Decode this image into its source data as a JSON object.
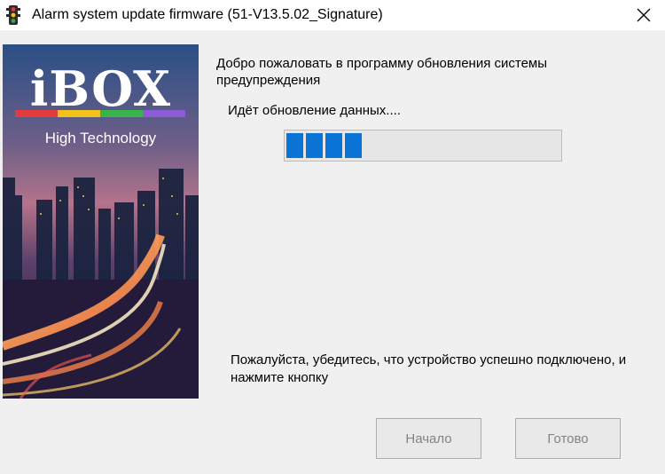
{
  "window": {
    "title": "Alarm system update firmware (51-V13.5.02_Signature)",
    "icon": "traffic-light-icon",
    "close_icon": "close-icon"
  },
  "banner": {
    "logo_text": "iBOX",
    "tagline": "High Technology",
    "stripe_colors": [
      "#e23b3b",
      "#f2c31a",
      "#38b54a",
      "#8e5bd6"
    ]
  },
  "main": {
    "welcome": "Добро пожаловать в программу обновления системы предупреждения",
    "status": "Идёт обновление данных....",
    "progress_segments_filled": 4,
    "progress_color": "#0a74d6",
    "hint": "Пожалуйста, убедитесь, что устройство успешно подключено, и нажмите кнопку"
  },
  "buttons": {
    "start_label": "Начало",
    "done_label": "Готово"
  }
}
